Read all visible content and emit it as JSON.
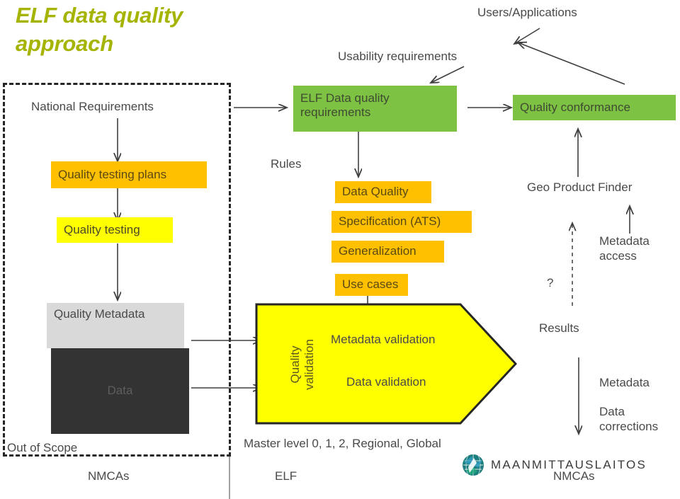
{
  "title": "ELF data quality\napproach",
  "title_color": "#A5B400",
  "labels": {
    "national_requirements": "National Requirements",
    "usability_requirements": "Usability requirements",
    "users_applications": "Users/Applications",
    "rules": "Rules",
    "geo_product_finder": "Geo Product Finder",
    "metadata_access": "Metadata\naccess",
    "question_mark": "?",
    "results": "Results",
    "metadata_corrections": "Metadata\n\nData\ncorrections",
    "out_of_scope": "Out of Scope",
    "nmcas_left": "NMCAs",
    "nmcas_right": "NMCAs",
    "master_level": "Master level 0, 1, 2, Regional, Global",
    "elf": "ELF"
  },
  "boxes": {
    "elf_data_quality_requirements": {
      "text": "ELF Data quality\nrequirements",
      "color": "#7DC242"
    },
    "quality_conformance": {
      "text": "Quality conformance",
      "color": "#7DC242"
    },
    "quality_testing_plans": {
      "text": "Quality testing plans",
      "color": "#FFC000"
    },
    "quality_testing": {
      "text": "Quality testing",
      "color": "#FFFF00"
    },
    "quality_metadata": {
      "text": "Quality\nMetadata",
      "color": "#D9D9D9"
    },
    "data": {
      "text": "Data",
      "color": "#333333"
    },
    "data_quality": {
      "text": "Data Quality",
      "color": "#FFC000"
    },
    "specification_ats": {
      "text": "Specification (ATS)",
      "color": "#FFC000"
    },
    "generalization": {
      "text": "Generalization",
      "color": "#FFC000"
    },
    "use_cases": {
      "text": "Use cases",
      "color": "#FFC000"
    }
  },
  "pentagon": {
    "side_label": "Quality\nvalidation",
    "color": "#FFFF00",
    "items": [
      "Metadata validation",
      "Data validation"
    ]
  },
  "logo": {
    "name": "maanmittauslaitos-logo",
    "text": "MAANMITTAUSLAITOS",
    "color": "#1a8a8a"
  }
}
